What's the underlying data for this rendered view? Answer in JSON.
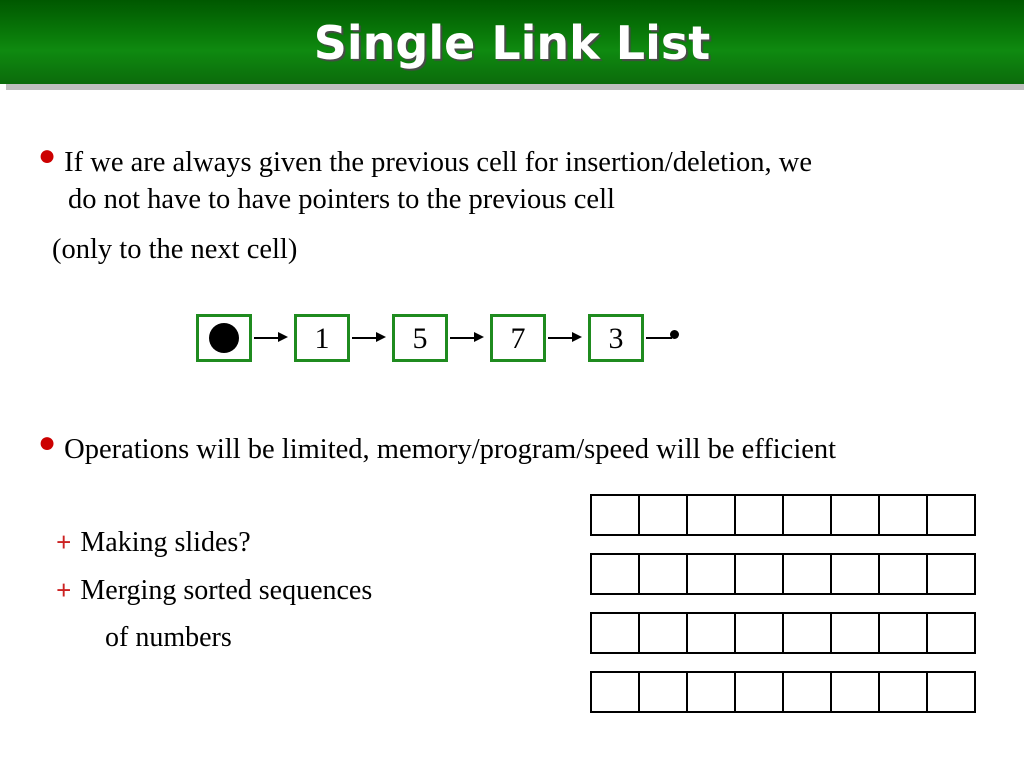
{
  "slide": {
    "title": "Single Link List",
    "title_bar_color": "#0b7a0b",
    "accent_bullet_color": "#cc0000",
    "cell_border_color": "#1f8b1f"
  },
  "paragraphs": {
    "bullet1_line1": "If we are always given the previous cell for insertion/deletion, we",
    "bullet1_line2": "do not have to have pointers to the previous cell",
    "bullet1_line3": "(only to the next cell)",
    "bullet2": "Operations will be limited, memory/program/speed will be efficient"
  },
  "bullets": {
    "dot_glyph": "●",
    "plus_glyph": "+"
  },
  "linked_list": {
    "head_label": "",
    "nodes": [
      "1",
      "5",
      "7",
      "3"
    ],
    "head_icon": "filled-circle-icon",
    "arrow_icon": "arrow-right-icon",
    "tail_icon": "dot-terminator-icon"
  },
  "sub_bullets": [
    {
      "label": "Making slides?"
    },
    {
      "label": "Merging sorted sequences"
    },
    {
      "label": "of numbers"
    }
  ],
  "grids": {
    "rows": 4,
    "columns": 8,
    "cell_value": ""
  }
}
